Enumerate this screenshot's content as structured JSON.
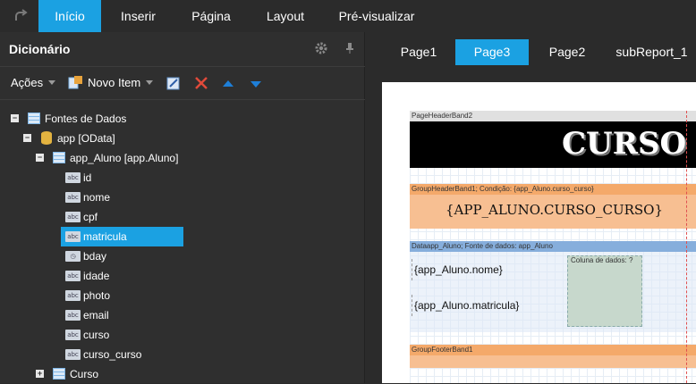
{
  "menu": {
    "undo_icon": "redo-arrow-icon",
    "tabs": [
      {
        "label": "Início",
        "active": true
      },
      {
        "label": "Inserir"
      },
      {
        "label": "Página"
      },
      {
        "label": "Layout"
      },
      {
        "label": "Pré-visualizar"
      }
    ]
  },
  "dictionary": {
    "title": "Dicionário",
    "toolbar": {
      "actions_label": "Ações",
      "new_item_label": "Novo Item"
    },
    "tree": [
      {
        "label": "Fontes de Dados",
        "level": 0,
        "icon": "table",
        "expander": "−"
      },
      {
        "label": "app [OData]",
        "level": 1,
        "icon": "db",
        "expander": "−"
      },
      {
        "label": "app_Aluno [app.Aluno]",
        "level": 2,
        "icon": "table",
        "expander": "−"
      },
      {
        "label": "id",
        "level": 3,
        "icon": "abc"
      },
      {
        "label": "nome",
        "level": 3,
        "icon": "abc"
      },
      {
        "label": "cpf",
        "level": 3,
        "icon": "abc"
      },
      {
        "label": "matricula",
        "level": 3,
        "icon": "abc",
        "selected": true
      },
      {
        "label": "bday",
        "level": 3,
        "icon": "date"
      },
      {
        "label": "idade",
        "level": 3,
        "icon": "abc"
      },
      {
        "label": "photo",
        "level": 3,
        "icon": "abc"
      },
      {
        "label": "email",
        "level": 3,
        "icon": "abc"
      },
      {
        "label": "curso",
        "level": 3,
        "icon": "abc"
      },
      {
        "label": "curso_curso",
        "level": 3,
        "icon": "abc"
      },
      {
        "label": "Curso",
        "level": 2,
        "icon": "table",
        "expander": "+"
      }
    ]
  },
  "pages": {
    "tabs": [
      {
        "label": "Page1"
      },
      {
        "label": "Page3",
        "active": true
      },
      {
        "label": "Page2"
      },
      {
        "label": "subReport_1"
      }
    ]
  },
  "report": {
    "page_header_title": "PageHeaderBand2",
    "banner_text": "CURSO L",
    "group_header_title": "GroupHeaderBand1; Condição: {app_Aluno.curso_curso}",
    "group_header_field": "{APP_ALUNO.CURSO_CURSO}",
    "data_band_title": "Dataapp_Aluno; Fonte de dados: app_Aluno",
    "field_nome": "{app_Aluno.nome}",
    "field_matricula": "{app_Aluno.matricula}",
    "column_box_label": "Coluna de dados: ?",
    "group_footer_title": "GroupFooterBand1"
  },
  "colors": {
    "accent": "#1ba1e2",
    "group_band": "#f4a96a",
    "data_band": "#86aedc"
  }
}
